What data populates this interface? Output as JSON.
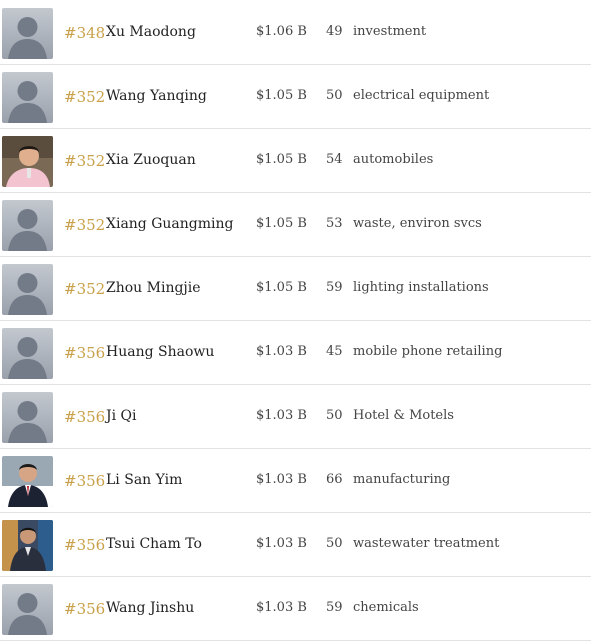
{
  "rows": [
    {
      "rank": "#348",
      "name": "Xu Maodong",
      "worth": "$1.06 B",
      "age": "49",
      "industry": "investment",
      "avatar": "placeholder"
    },
    {
      "rank": "#352",
      "name": "Wang Yanqing",
      "worth": "$1.05 B",
      "age": "50",
      "industry": "electrical equipment",
      "avatar": "placeholder"
    },
    {
      "rank": "#352",
      "name": "Xia Zuoquan",
      "worth": "$1.05 B",
      "age": "54",
      "industry": "automobiles",
      "avatar": "photo"
    },
    {
      "rank": "#352",
      "name": "Xiang Guangming",
      "worth": "$1.05 B",
      "age": "53",
      "industry": "waste, environ svcs",
      "avatar": "placeholder"
    },
    {
      "rank": "#352",
      "name": "Zhou Mingjie",
      "worth": "$1.05 B",
      "age": "59",
      "industry": "lighting installations",
      "avatar": "placeholder"
    },
    {
      "rank": "#356",
      "name": "Huang Shaowu",
      "worth": "$1.03 B",
      "age": "45",
      "industry": "mobile phone retailing",
      "avatar": "placeholder"
    },
    {
      "rank": "#356",
      "name": "Ji Qi",
      "worth": "$1.03 B",
      "age": "50",
      "industry": "Hotel & Motels",
      "avatar": "placeholder"
    },
    {
      "rank": "#356",
      "name": "Li San Yim",
      "worth": "$1.03 B",
      "age": "66",
      "industry": "manufacturing",
      "avatar": "photo"
    },
    {
      "rank": "#356",
      "name": "Tsui Cham To",
      "worth": "$1.03 B",
      "age": "50",
      "industry": "wastewater treatment",
      "avatar": "photo"
    },
    {
      "rank": "#356",
      "name": "Wang Jinshu",
      "worth": "$1.03 B",
      "age": "59",
      "industry": "chemicals",
      "avatar": "placeholder"
    }
  ],
  "colors": {
    "rank": "#c9a14a",
    "placeholder_bg": "#a9afb9",
    "placeholder_figure": "#6f7684"
  }
}
